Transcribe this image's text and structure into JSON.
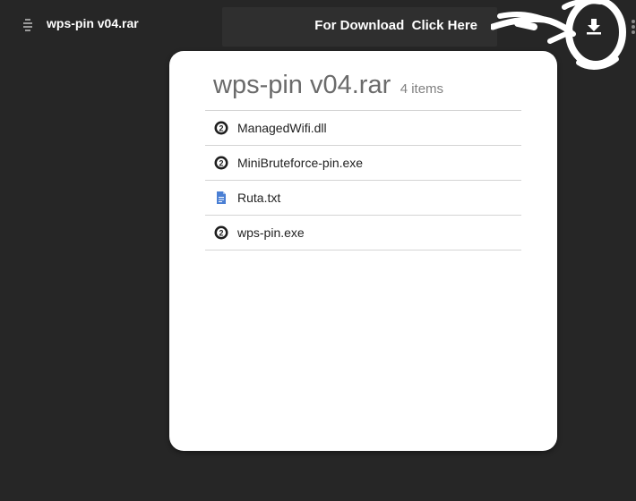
{
  "topbar": {
    "file_title": "wps-pin v04.rar",
    "archive_icon": "archive-icon",
    "download_banner": "For Download  Click Here",
    "download_icon": "download-icon",
    "more_icon": "more-vert-icon"
  },
  "archive": {
    "title": "wps-pin v04.rar",
    "count": "4 items",
    "files": [
      {
        "name": "ManagedWifi.dll",
        "icon": "generic-file-icon"
      },
      {
        "name": "MiniBruteforce-pin.exe",
        "icon": "generic-file-icon"
      },
      {
        "name": "Ruta.txt",
        "icon": "text-document-icon"
      },
      {
        "name": "wps-pin.exe",
        "icon": "generic-file-icon"
      }
    ]
  },
  "colors": {
    "background": "#262626",
    "card": "#ffffff",
    "text_document_icon": "#4a7fd4",
    "generic_icon": "#222222"
  }
}
